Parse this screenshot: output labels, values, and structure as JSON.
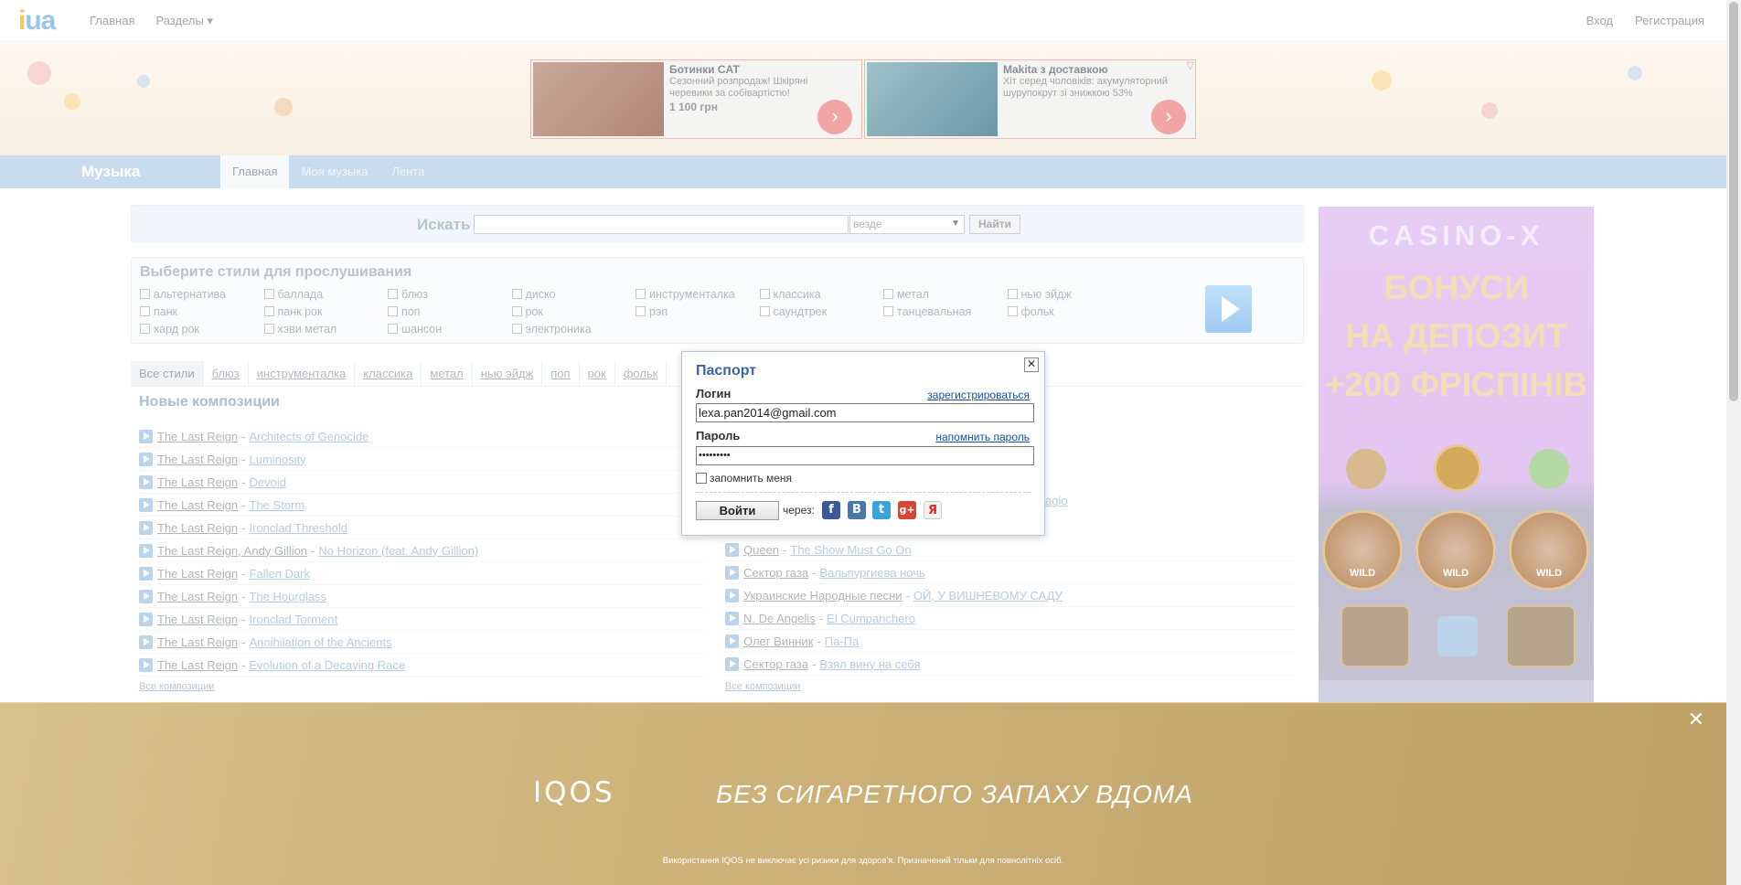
{
  "topbar": {
    "logo_i": "i",
    "logo_text": "ua",
    "nav": [
      {
        "label": "Главная"
      },
      {
        "label": "Разделы ▾"
      }
    ],
    "right": [
      {
        "label": "Вход"
      },
      {
        "label": "Регистрация"
      }
    ]
  },
  "ads": [
    {
      "title": "Ботинки CAT",
      "desc": "Сезонний розпродаж! Шкіряні черевики за собівартістю!",
      "price": "1 100 грн"
    },
    {
      "title": "Makita з доставкою",
      "desc": "Хіт серед чоловіків: акумуляторний шурупокрут зі знижкою 53%",
      "price": ""
    }
  ],
  "music": {
    "title": "Музыка",
    "tabs": [
      {
        "label": "Главная"
      },
      {
        "label": "Моя музыка"
      },
      {
        "label": "Лента"
      }
    ]
  },
  "search": {
    "label": "Искать",
    "value": "",
    "scope": "везде",
    "button": "Найти"
  },
  "styles": {
    "heading": "Выберите стили для прослушивания",
    "items": [
      "альтернатива",
      "баллада",
      "блюз",
      "диско",
      "инструменталка",
      "классика",
      "метал",
      "нью эйдж",
      "панк",
      "панк рок",
      "поп",
      "рок",
      "рэп",
      "саундтрек",
      "танцевальная",
      "фольк",
      "хард рок",
      "хэви метал",
      "шансон",
      "электроника"
    ]
  },
  "filter": [
    {
      "label": "Все стили"
    },
    {
      "label": "блюз"
    },
    {
      "label": "инструменталка"
    },
    {
      "label": "классика"
    },
    {
      "label": "метал"
    },
    {
      "label": "нью эйдж"
    },
    {
      "label": "поп"
    },
    {
      "label": "рок"
    },
    {
      "label": "фольк"
    }
  ],
  "new_heading": "Новые композиции",
  "songs_left": [
    {
      "artist": "The Last Reign",
      "track": "Architects of Genocide"
    },
    {
      "artist": "The Last Reign",
      "track": "Luminosity"
    },
    {
      "artist": "The Last Reign",
      "track": "Devoid"
    },
    {
      "artist": "The Last Reign",
      "track": "The Storm"
    },
    {
      "artist": "The Last Reign",
      "track": "Ironclad Threshold"
    },
    {
      "artist": "The Last Reign, Andy Gillion",
      "track": "No Horizon (feat. Andy Gillion)"
    },
    {
      "artist": "The Last Reign",
      "track": "Fallen Dark"
    },
    {
      "artist": "The Last Reign",
      "track": "The Hourglass"
    },
    {
      "artist": "The Last Reign",
      "track": "Ironclad Torment"
    },
    {
      "artist": "The Last Reign",
      "track": "Annihilation of the Ancients"
    },
    {
      "artist": "The Last Reign",
      "track": "Evolution of a Decaying Race"
    }
  ],
  "songs_right": [
    {
      "artist": "Queen",
      "track": "The Show Must Go On"
    },
    {
      "artist": "Сектор газа",
      "track": "Вальпургиева ночь"
    },
    {
      "artist": "Украинские Народные песни",
      "track": "ОЙ, У ВИШНЕВОМУ САДУ"
    },
    {
      "artist": "N. De Angelis",
      "track": "El Cumpanchero"
    },
    {
      "artist": "Олег Винник",
      "track": "Па-Па"
    },
    {
      "artist": "Сектор газа",
      "track": "Взял вину на себя"
    }
  ],
  "right_partial_track": "agio",
  "all_songs": "Все композиции",
  "casino": {
    "brand": "CASINO-X",
    "lines": [
      "БОНУСИ",
      "НА ДЕПОЗИТ",
      "+200 ФРІСПІНІВ"
    ],
    "wild": "WILD"
  },
  "dialog": {
    "title": "Паспорт",
    "close": "✕",
    "login_label": "Логин",
    "register_link": "зарегистрироваться",
    "login_value": "lexa.pan2014@gmail.com",
    "password_label": "Пароль",
    "remind_link": "напомнить пароль",
    "password_value": "•••••••••",
    "remember": "запомнить меня",
    "submit": "Войти",
    "via": "через:",
    "socials": [
      {
        "glyph": "f",
        "color": "#3b5998"
      },
      {
        "glyph": "B",
        "color": "#4a76a8"
      },
      {
        "glyph": "t",
        "color": "#3aa3d9"
      },
      {
        "glyph": "g+",
        "color": "#d34836"
      },
      {
        "glyph": "Я",
        "color": "#e8e8e8"
      }
    ]
  },
  "iqos": {
    "brand": "IQOS",
    "slogan": "БЕЗ СИГАРЕТНОГО ЗАПАХУ ВДОМА",
    "disclaimer": "Використання IQOS не виключає усі ризики для здоров'я. Призначений тільки для повнолітніх осіб.",
    "close": "✕"
  },
  "colors": {
    "accent": "#3a66a0",
    "music_bar": "#c9dcee",
    "iqos_gold": "#cfb47c",
    "casino_purple": "#e3c6f2"
  }
}
